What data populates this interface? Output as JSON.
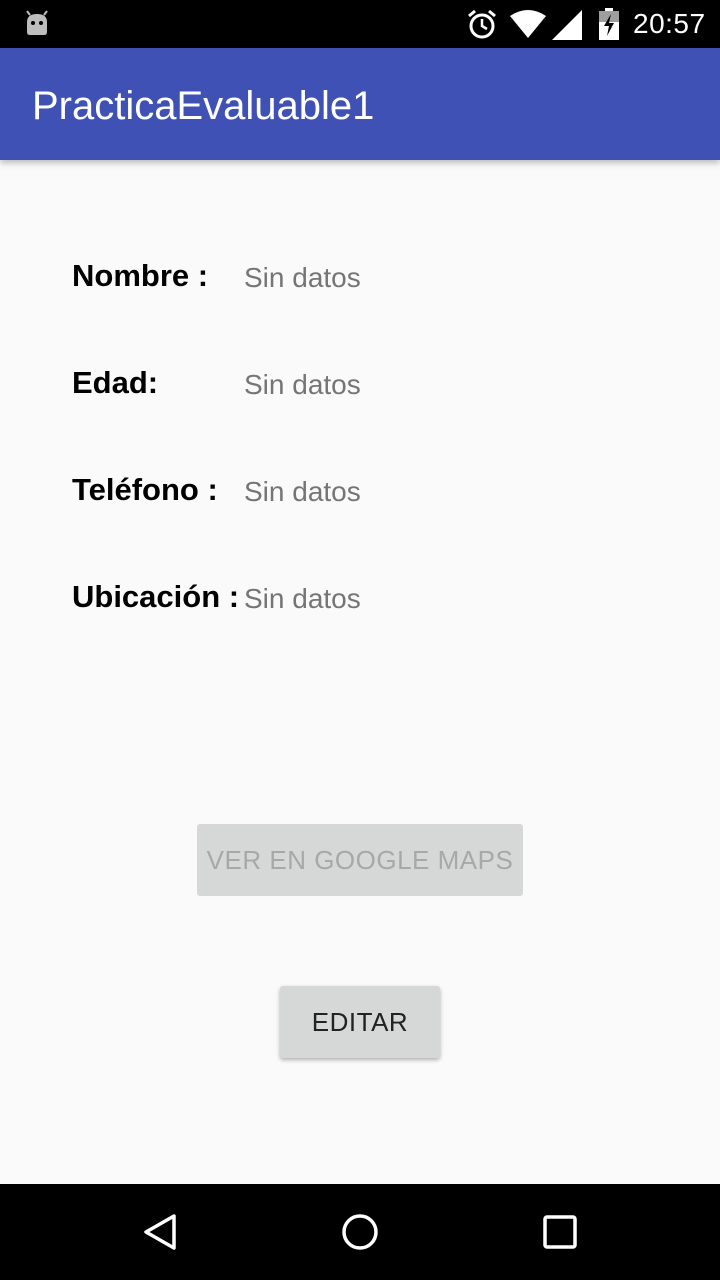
{
  "status_bar": {
    "time": "20:57",
    "icons": [
      "android-notification-icon",
      "alarm-icon",
      "wifi-icon",
      "signal-icon",
      "battery-icon"
    ]
  },
  "app_bar": {
    "title": "PracticaEvaluable1",
    "color": "#3f51b5"
  },
  "fields": {
    "nombre": {
      "label": "Nombre :",
      "value": "Sin datos"
    },
    "edad": {
      "label": "Edad:",
      "value": "Sin datos"
    },
    "telefono": {
      "label": "Teléfono :",
      "value": "Sin datos"
    },
    "ubicacion": {
      "label": "Ubicación :",
      "value": "Sin datos"
    }
  },
  "buttons": {
    "maps_label": "VER EN GOOGLE MAPS",
    "maps_enabled": false,
    "edit_label": "EDITAR"
  },
  "nav_bar": {
    "icons": [
      "back-icon",
      "home-icon",
      "recents-icon"
    ]
  }
}
